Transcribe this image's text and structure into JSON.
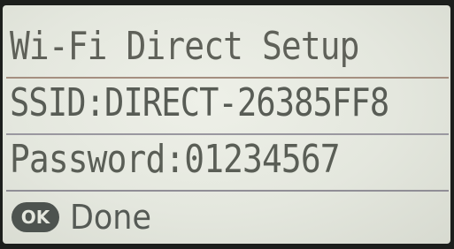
{
  "screen": {
    "title": "Wi-Fi Direct Setup",
    "ssid_text": "SSID:DIRECT-26385FF8",
    "password_text": "Password:01234567"
  },
  "footer": {
    "ok_icon_label": "OK",
    "done_label": "Done"
  },
  "colors": {
    "lcd_background": "#e6e9e0",
    "lcd_text": "#5b5f57",
    "bezel": "#1c1e1c",
    "ok_badge": "#4d534f"
  },
  "icons": {
    "ok_button": "ok-badge-icon"
  }
}
